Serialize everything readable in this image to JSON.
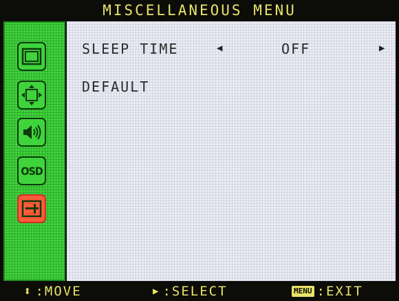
{
  "title": "MISCELLANEOUS MENU",
  "sidebar": {
    "items": [
      {
        "icon": "picture-icon",
        "active": false
      },
      {
        "icon": "position-icon",
        "active": false
      },
      {
        "icon": "audio-icon",
        "active": false
      },
      {
        "icon": "osd-icon",
        "label": "OSD",
        "active": false
      },
      {
        "icon": "miscellaneous-icon",
        "active": true
      }
    ]
  },
  "menu": {
    "sleep_time": {
      "label": "SLEEP TIME",
      "left_arrow": "◀",
      "value": "OFF",
      "right_arrow": "▶"
    },
    "default": {
      "label": "DEFAULT"
    }
  },
  "footer": {
    "move": {
      "glyph": "⬍",
      "label": ":MOVE"
    },
    "select": {
      "glyph": "▶",
      "label": ":SELECT"
    },
    "exit": {
      "key": "MENU",
      "label": ":EXIT"
    }
  },
  "colors": {
    "title_text": "#e8e46a",
    "sidebar_green": "#3fd43b",
    "active_icon": "#ff5a38",
    "content_bg": "#ecedf4"
  }
}
